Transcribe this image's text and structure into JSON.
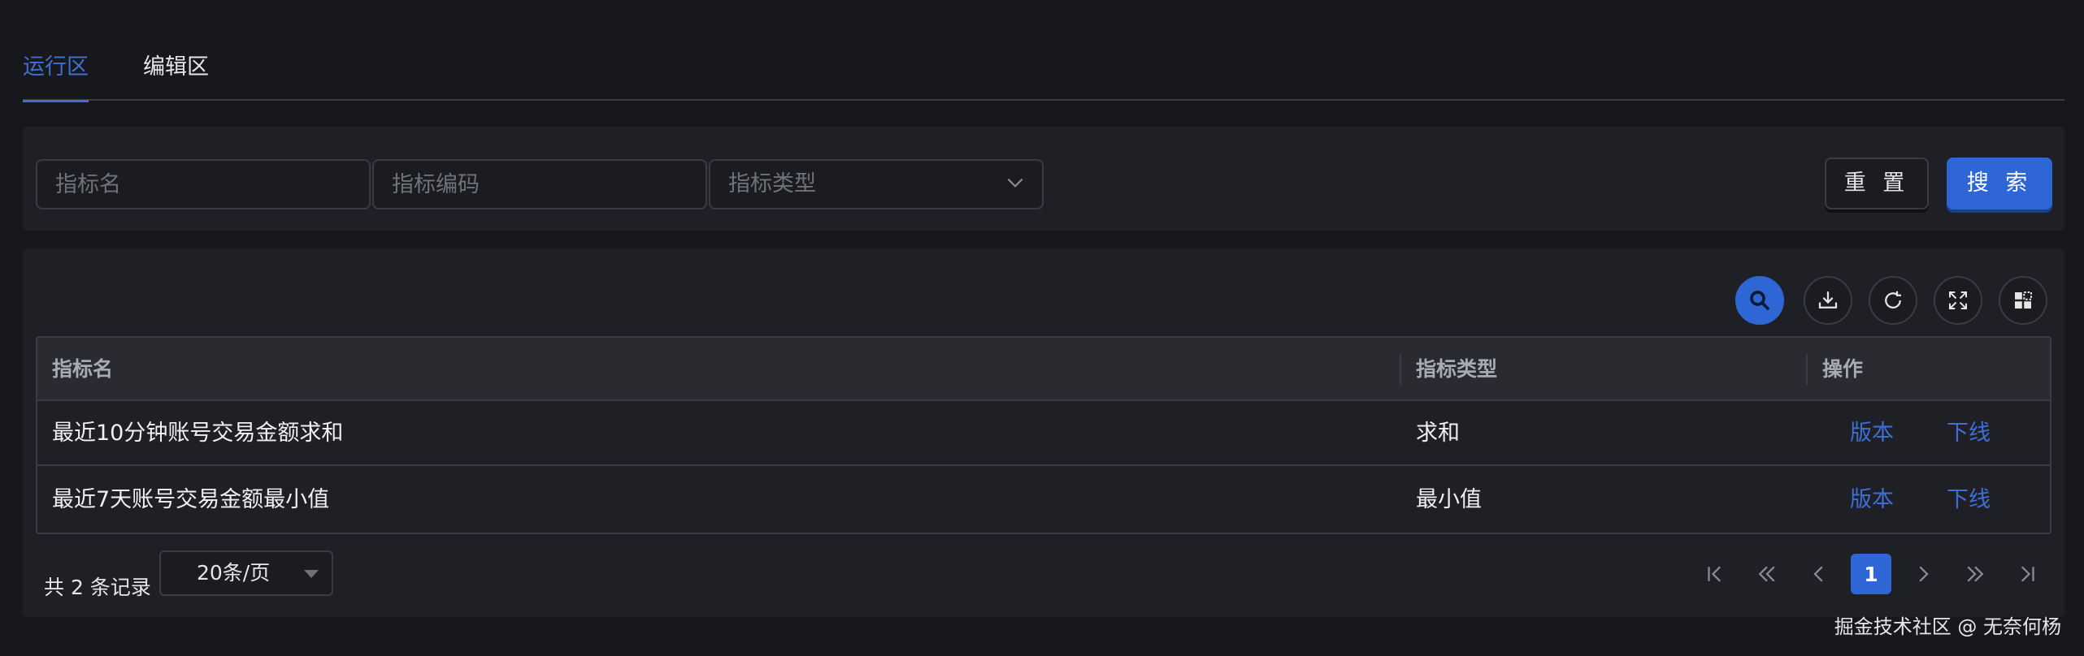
{
  "tabs": [
    {
      "label": "运行区",
      "active": true
    },
    {
      "label": "编辑区",
      "active": false
    }
  ],
  "search": {
    "name_placeholder": "指标名",
    "code_placeholder": "指标编码",
    "type_placeholder": "指标类型",
    "reset_label": "重 置",
    "search_label": "搜 索"
  },
  "toolbar": {
    "icons": [
      "search-icon",
      "download-icon",
      "refresh-icon",
      "fullscreen-icon",
      "column-settings-icon"
    ]
  },
  "table": {
    "columns": [
      "指标名",
      "指标类型",
      "操作"
    ],
    "rows": [
      {
        "name": "最近10分钟账号交易金额求和",
        "type": "求和",
        "actions": [
          "版本",
          "下线"
        ]
      },
      {
        "name": "最近7天账号交易金额最小值",
        "type": "最小值",
        "actions": [
          "版本",
          "下线"
        ]
      }
    ]
  },
  "pagination": {
    "total_text": "共 2 条记录",
    "page_size": "20条/页",
    "current_page": "1"
  },
  "watermark": "掘金技术社区 @ 无奈何杨",
  "colors": {
    "accent": "#2f66d6",
    "link": "#3d6fd6",
    "background": "#17181c",
    "panel": "#1f2025"
  }
}
